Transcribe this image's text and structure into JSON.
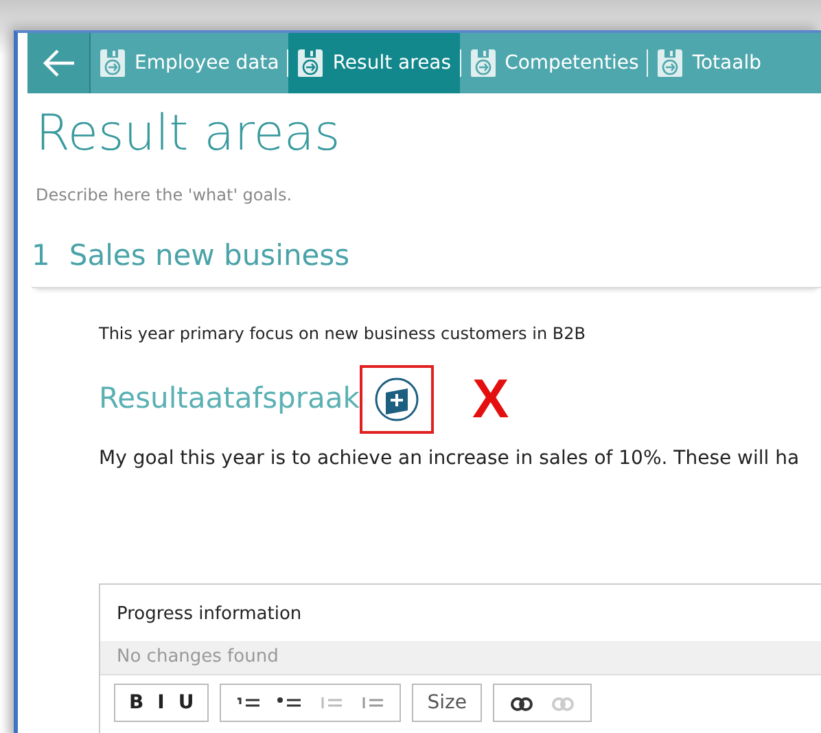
{
  "tabs": [
    {
      "label": "Employee data",
      "selected": false
    },
    {
      "label": "Result areas",
      "selected": true
    },
    {
      "label": "Competenties",
      "selected": false
    },
    {
      "label": "Totaalb",
      "selected": false
    }
  ],
  "page": {
    "title": "Result areas",
    "description": "Describe here the 'what' goals."
  },
  "section": {
    "number": "1",
    "title": "Sales new business",
    "summary": "This year primary focus on new business customers in B2B",
    "agreement_title": "Resultaatafspraak",
    "annotation": "X",
    "goal": "My goal this year is to achieve an increase in sales of 10%. These will ha"
  },
  "progress": {
    "title": "Progress information",
    "status": "No changes found",
    "toolbar": [
      {
        "kind": "buttons",
        "items": [
          "B",
          "I",
          "U"
        ]
      },
      {
        "kind": "list-icons"
      },
      {
        "kind": "dropdown",
        "items": [
          "Size"
        ]
      },
      {
        "kind": "link-icons"
      }
    ]
  }
}
